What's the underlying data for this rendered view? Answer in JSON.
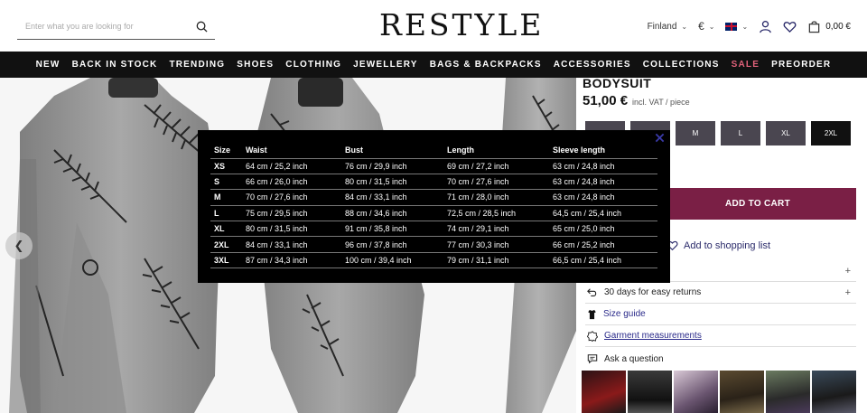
{
  "header": {
    "search_placeholder": "Enter what you are looking for",
    "logo": "RESTYLE",
    "country": "Finland",
    "currency": "€",
    "cart_total": "0,00 €"
  },
  "nav": {
    "items": [
      "NEW",
      "BACK IN STOCK",
      "TRENDING",
      "SHOES",
      "CLOTHING",
      "JEWELLERY",
      "BAGS & BACKPACKS",
      "ACCESSORIES",
      "COLLECTIONS",
      "SALE",
      "PREORDER"
    ]
  },
  "product": {
    "title": "BODYSUIT",
    "price": "51,00 €",
    "price_note": "incl. VAT / piece",
    "sizes": [
      "",
      "",
      "M",
      "L",
      "XL",
      "2XL"
    ],
    "add_to_cart": "ADD TO CART",
    "shopping_list": "Add to shopping list",
    "info": {
      "returns": "30 days for easy returns",
      "size_guide": "Size guide",
      "garment": "Garment measurements",
      "ask": "Ask a question"
    }
  },
  "size_chart": {
    "headers": [
      "Size",
      "Waist",
      "Bust",
      "Length",
      "Sleeve length"
    ],
    "rows": [
      [
        "XS",
        "64 cm / 25,2 inch",
        "76 cm / 29,9 inch",
        "69 cm / 27,2 inch",
        "63 cm / 24,8 inch"
      ],
      [
        "S",
        "66 cm / 26,0 inch",
        "80 cm / 31,5 inch",
        "70 cm / 27,6 inch",
        "63 cm / 24,8 inch"
      ],
      [
        "M",
        "70 cm / 27,6 inch",
        "84 cm / 33,1 inch",
        "71 cm / 28,0 inch",
        "63 cm / 24,8 inch"
      ],
      [
        "L",
        "75 cm / 29,5 inch",
        "88 cm / 34,6 inch",
        "72,5 cm / 28,5 inch",
        "64,5 cm / 25,4 inch"
      ],
      [
        "XL",
        "80 cm / 31,5 inch",
        "91 cm / 35,8 inch",
        "74 cm / 29,1 inch",
        "65 cm / 25,0 inch"
      ],
      [
        "2XL",
        "84 cm / 33,1 inch",
        "96 cm / 37,8 inch",
        "77 cm / 30,3 inch",
        "66 cm / 25,2 inch"
      ],
      [
        "3XL",
        "87 cm / 34,3 inch",
        "100 cm / 39,4 inch",
        "79 cm / 31,1 inch",
        "66,5 cm / 25,4 inch"
      ]
    ]
  },
  "colors": {
    "nav_bg": "#111111",
    "sale": "#e0627a",
    "add_to_cart_bg": "#7a1f45",
    "size_btn_bg": "#4a4650"
  }
}
